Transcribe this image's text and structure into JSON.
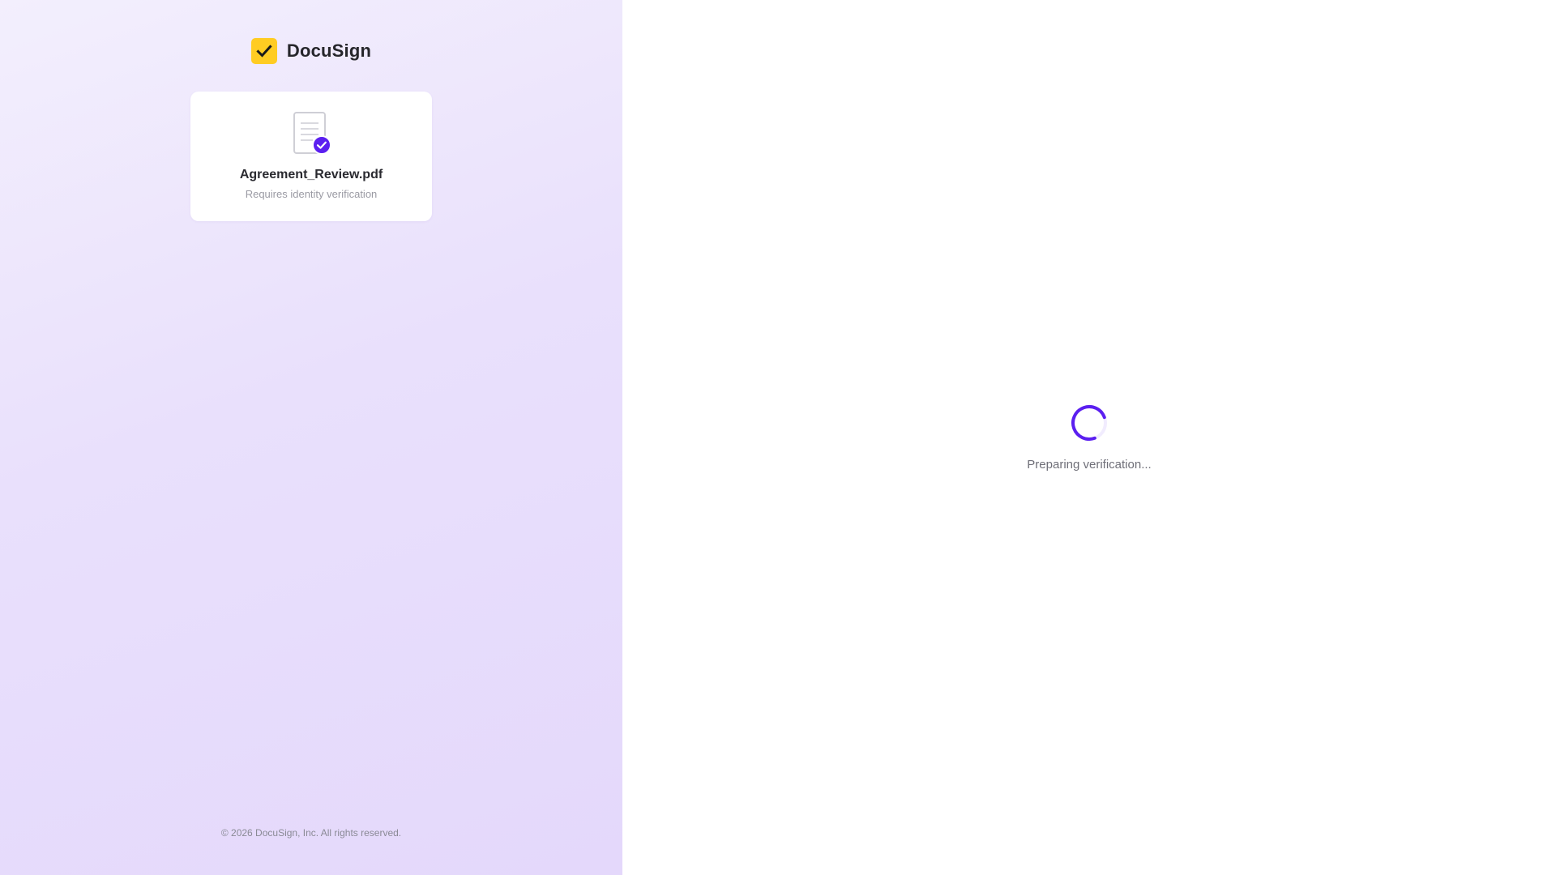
{
  "brand": {
    "name": "DocuSign",
    "logo_icon": "check-icon",
    "logo_color": "#ffcc22"
  },
  "document": {
    "filename": "Agreement_Review.pdf",
    "status": "Requires identity verification",
    "icon": "document-icon",
    "badge_icon": "verified-badge-icon",
    "badge_color": "#5b1ff0"
  },
  "footer": {
    "copyright": "© 2026 DocuSign, Inc. All rights reserved."
  },
  "loading": {
    "message": "Preparing verification...",
    "spinner_icon": "spinner-icon",
    "spinner_color": "#5b1ff0"
  }
}
